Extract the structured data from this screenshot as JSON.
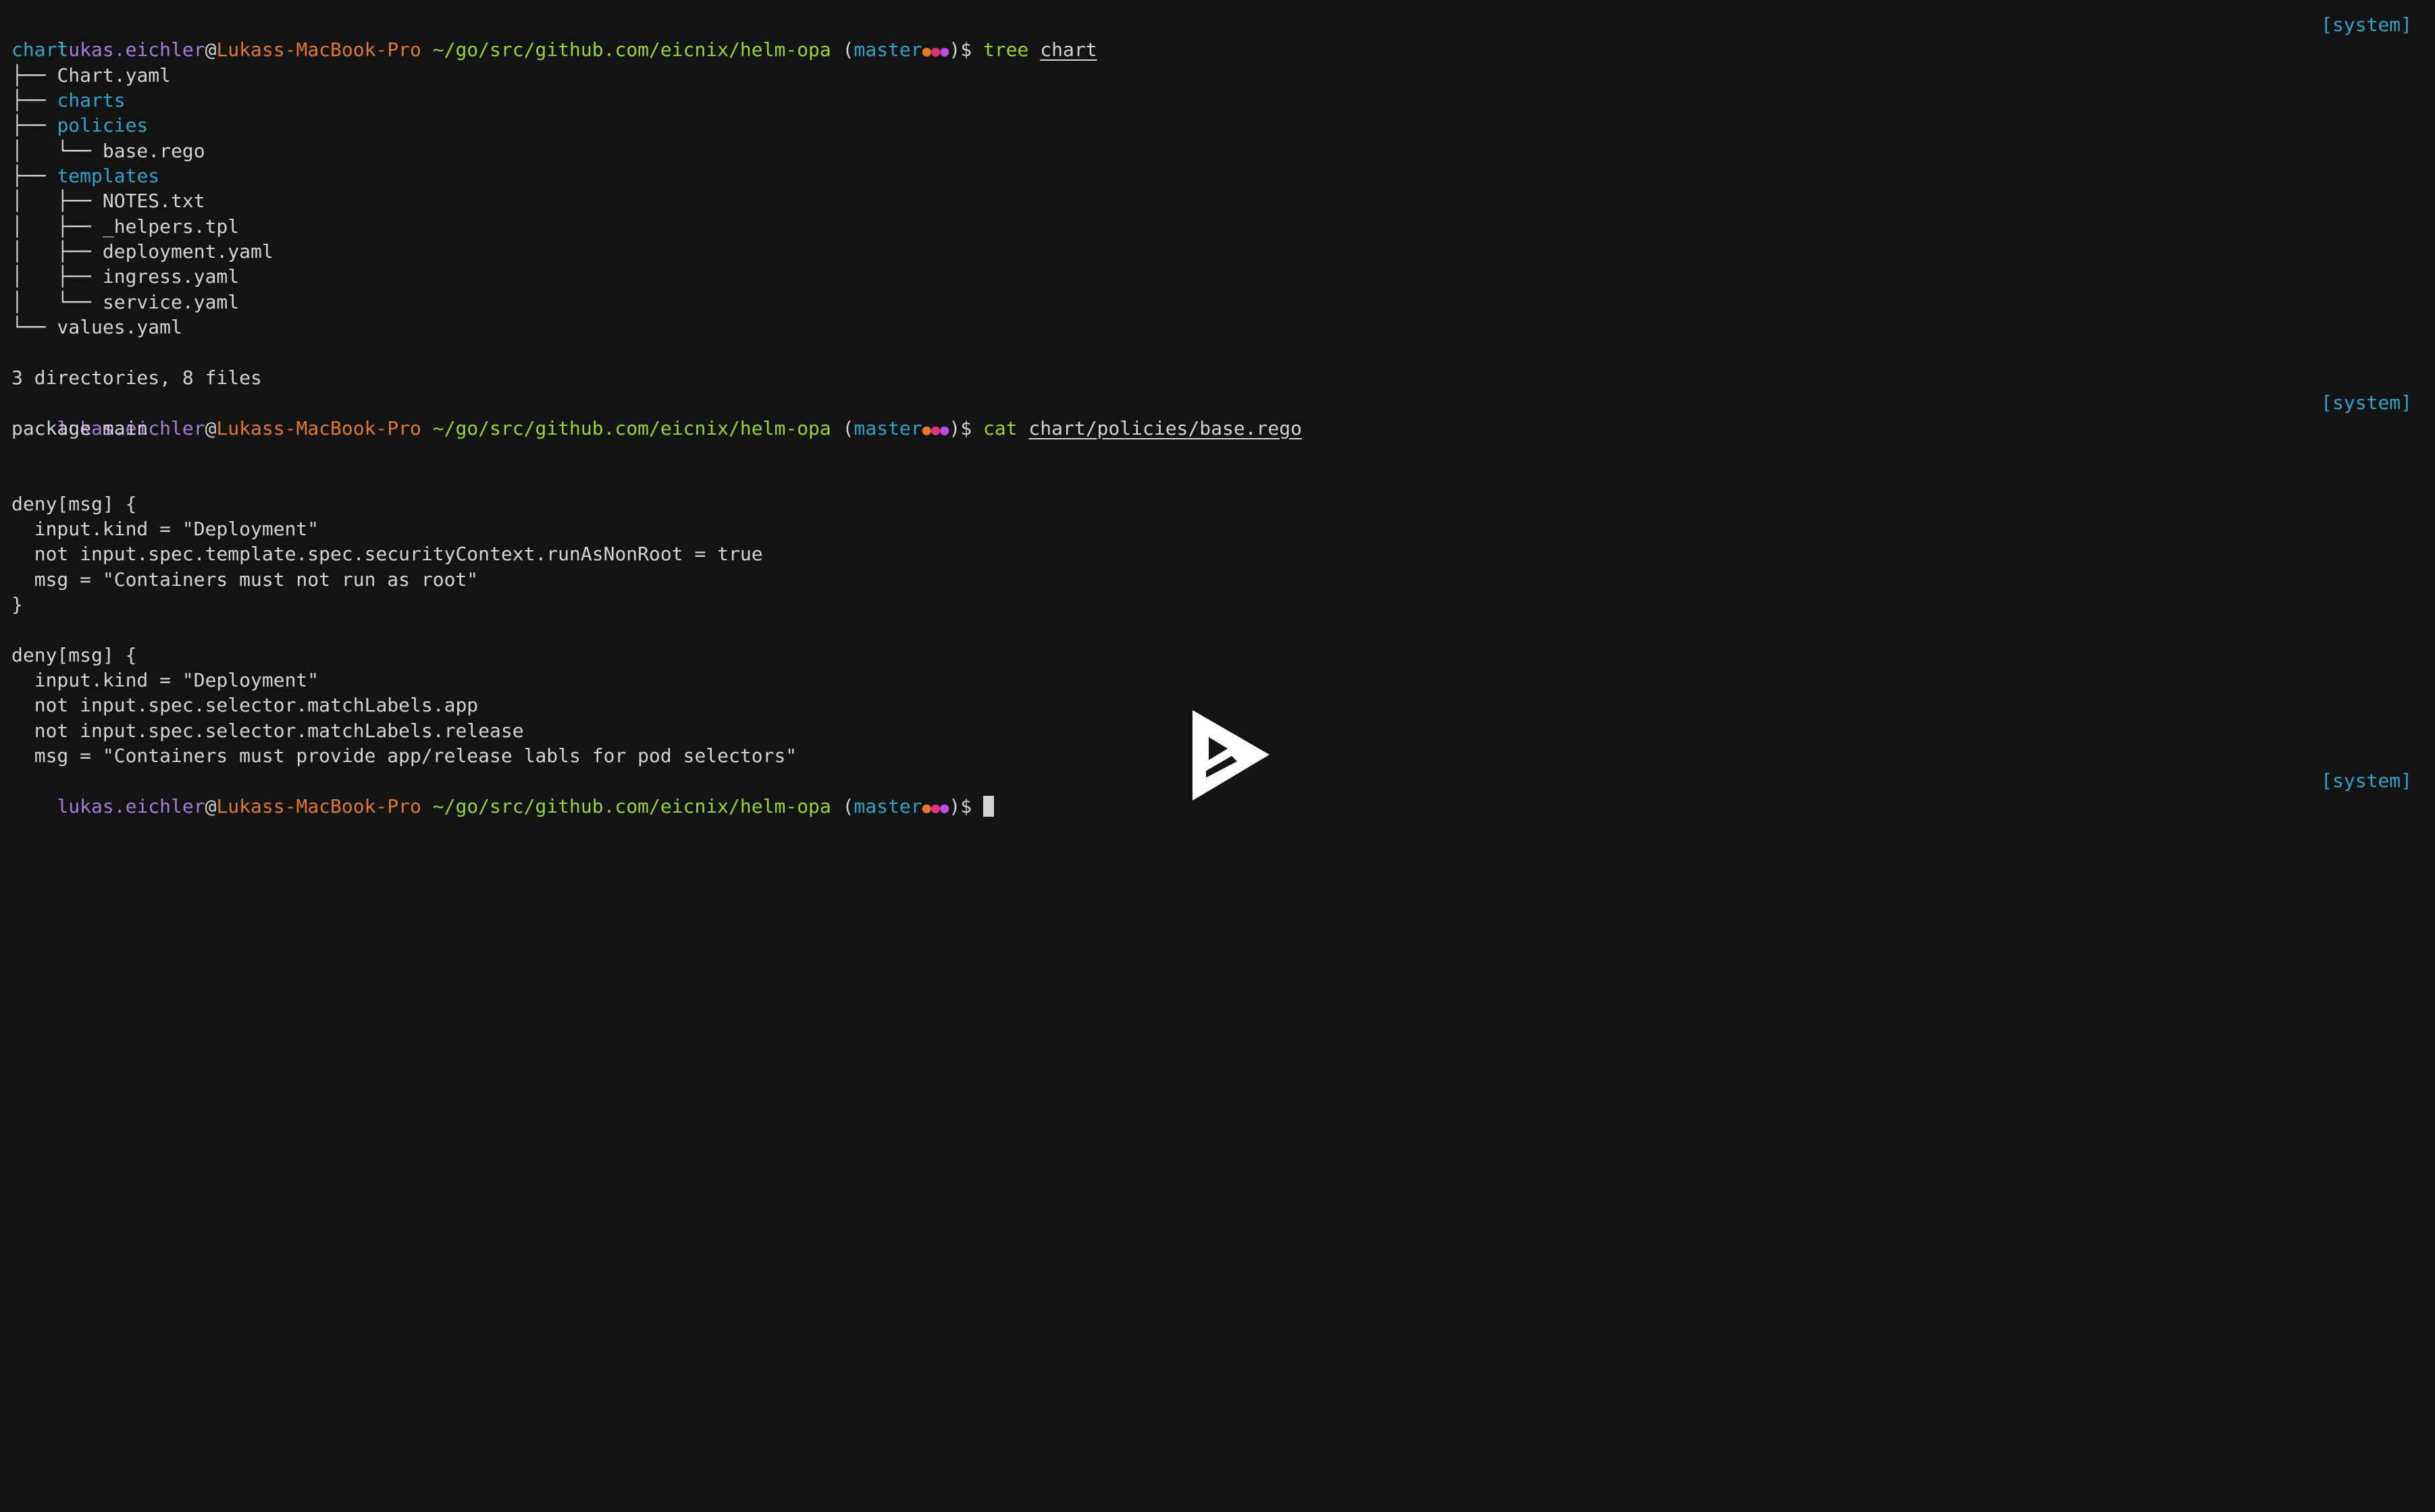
{
  "colors": {
    "background": "#121314",
    "text": "#d4d4d4",
    "user": "#a57ed8",
    "host": "#e3792d",
    "path": "#9bd62f",
    "branch": "#35a3c5",
    "command": "#9bd62f",
    "directory": "#35a3c5",
    "tag": "#35a3c5"
  },
  "prompt": {
    "user": "lukas.eichler",
    "at": "@",
    "host": "Lukass-MacBook-Pro",
    "path": "~/go/src/github.com/eicnix/helm-opa",
    "branch_open": "(",
    "branch": "master",
    "branch_dot_1": "●",
    "branch_dot_2": "●",
    "branch_dot_3": "●",
    "branch_close": ")",
    "symbol": "$",
    "tag": "[system]"
  },
  "commands": {
    "tree": {
      "name": "tree",
      "arg": "chart"
    },
    "cat": {
      "name": "cat",
      "arg": "chart/policies/base.rego"
    }
  },
  "tree": {
    "root": "chart",
    "items": [
      {
        "prefix": "├── ",
        "name": "Chart.yaml"
      },
      {
        "prefix": "├── ",
        "name": "charts"
      },
      {
        "prefix": "├── ",
        "name": "policies"
      },
      {
        "prefix": "│   └── ",
        "name": "base.rego"
      },
      {
        "prefix": "├── ",
        "name": "templates"
      },
      {
        "prefix": "│   ├── ",
        "name": "NOTES.txt"
      },
      {
        "prefix": "│   ├── ",
        "name": "_helpers.tpl"
      },
      {
        "prefix": "│   ├── ",
        "name": "deployment.yaml"
      },
      {
        "prefix": "│   ├── ",
        "name": "ingress.yaml"
      },
      {
        "prefix": "│   └── ",
        "name": "service.yaml"
      },
      {
        "prefix": "└── ",
        "name": "values.yaml"
      }
    ],
    "summary": "3 directories, 8 files"
  },
  "file_lines": [
    "package main",
    "",
    "",
    "deny[msg] {",
    "  input.kind = \"Deployment\"",
    "  not input.spec.template.spec.securityContext.runAsNonRoot = true",
    "  msg = \"Containers must not run as root\"",
    "}",
    "",
    "deny[msg] {",
    "  input.kind = \"Deployment\"",
    "  not input.spec.selector.matchLabels.app",
    "  not input.spec.selector.matchLabels.release",
    "  msg = \"Containers must provide app/release labls for pod selectors\""
  ],
  "icons": {
    "play": "asciinema-play-icon"
  }
}
